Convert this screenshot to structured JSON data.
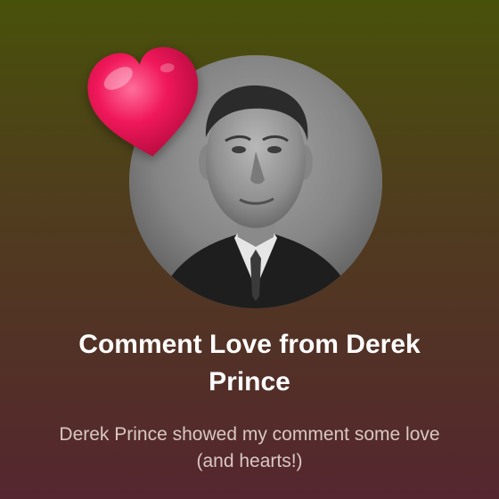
{
  "card": {
    "title": "Comment Love from Derek Prince",
    "subtitle": "Derek Prince showed my comment some love (and hearts!)"
  },
  "icons": {
    "heart": "heart-icon",
    "avatar": "avatar-photo"
  },
  "colors": {
    "gradient_top": "#48510a",
    "gradient_bottom": "#55262f",
    "heart": "#f0185a",
    "title": "#ffffff",
    "subtitle": "#d8c8c2"
  }
}
